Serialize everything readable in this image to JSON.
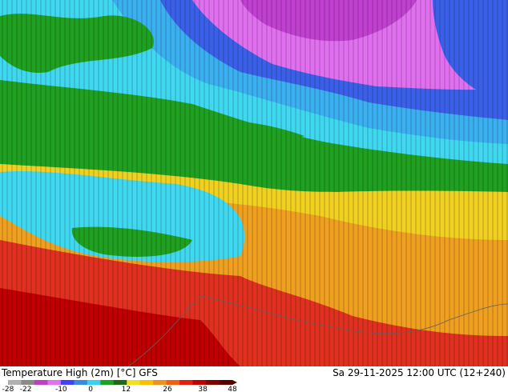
{
  "title": "Temperature High (2m) [°C] GFS",
  "valid_time": "Sa 29-11-2025 12:00 UTC (12+240)",
  "colorbar": {
    "ticks": [
      "-28",
      "-22",
      "-10",
      "0",
      "12",
      "26",
      "38",
      "48"
    ],
    "tick_values": [
      -28,
      -22,
      -10,
      0,
      12,
      26,
      38,
      48
    ],
    "range": [
      -28,
      48
    ],
    "colors": [
      "#b0b0b0",
      "#8a8a8a",
      "#c040c0",
      "#e070f0",
      "#4040ff",
      "#3a8ae0",
      "#3ad0f0",
      "#20a020",
      "#1a6a1a",
      "#f0e020",
      "#f8c000",
      "#f09020",
      "#f06010",
      "#e02010",
      "#c00000",
      "#800000",
      "#5a0000"
    ]
  },
  "map_colors": {
    "deep_purple": "#c040d0",
    "magenta": "#e070f0",
    "blue": "#3a60e8",
    "light_blue": "#3ab0f0",
    "cyan": "#40d8f0",
    "green": "#20a020",
    "yellow": "#f0d020",
    "orange": "#f0a020",
    "red": "#e03020",
    "dark_red": "#c00000"
  }
}
